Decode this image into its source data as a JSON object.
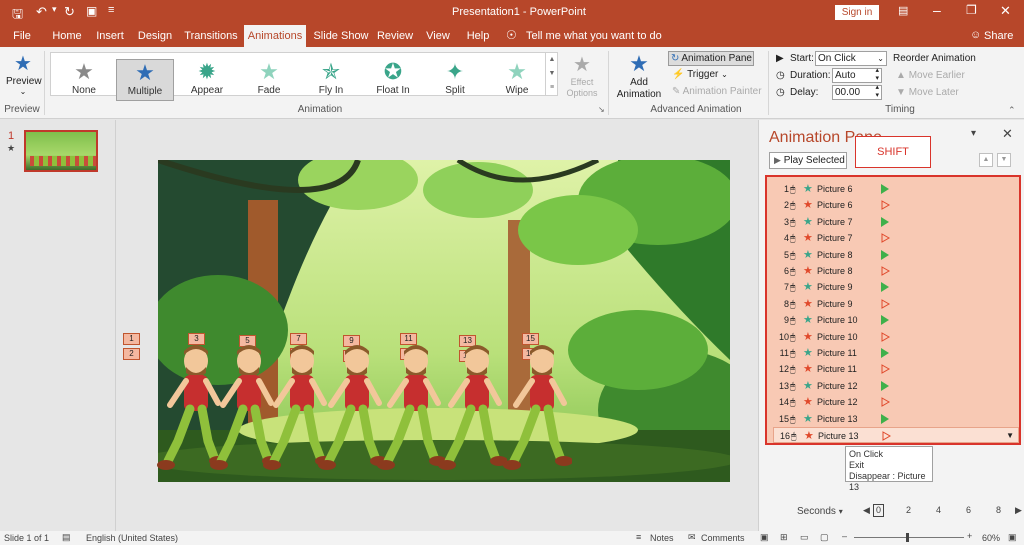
{
  "titlebar": {
    "title": "Presentation1  -  PowerPoint",
    "signin": "Sign in"
  },
  "tabs": [
    "File",
    "Home",
    "Insert",
    "Design",
    "Transitions",
    "Animations",
    "Slide Show",
    "Review",
    "View",
    "Help"
  ],
  "tell_me": "Tell me what you want to do",
  "share": "Share",
  "ribbon": {
    "preview_btn": "Preview",
    "preview_group": "Preview",
    "animations": [
      {
        "label": "None",
        "color": "#8a8a8a"
      },
      {
        "label": "Multiple",
        "color": "#2f6db5"
      },
      {
        "label": "Appear",
        "color": "#3aa58a"
      },
      {
        "label": "Fade",
        "color": "#3aa58a"
      },
      {
        "label": "Fly In",
        "color": "#3aa58a"
      },
      {
        "label": "Float In",
        "color": "#3aa58a"
      },
      {
        "label": "Split",
        "color": "#3aa58a"
      },
      {
        "label": "Wipe",
        "color": "#3aa58a"
      }
    ],
    "effect_options": "Effect Options",
    "animation_group": "Animation",
    "add_animation": "Add Animation",
    "animation_pane_btn": "Animation Pane",
    "trigger": "Trigger",
    "animation_painter": "Animation Painter",
    "advanced_group": "Advanced Animation",
    "start_label": "Start:",
    "start_value": "On Click",
    "duration_label": "Duration:",
    "duration_value": "Auto",
    "delay_label": "Delay:",
    "delay_value": "00.00",
    "timing_group": "Timing",
    "reorder_title": "Reorder Animation",
    "move_earlier": "Move Earlier",
    "move_later": "Move Later"
  },
  "slide_thumb_number": "1",
  "slide_tags": {
    "left": [
      "1",
      "2"
    ],
    "characters": [
      {
        "top": "3",
        "bottom": "4"
      },
      {
        "top": "5",
        "bottom": "6"
      },
      {
        "top": "7",
        "bottom": "8"
      },
      {
        "top": "9",
        "bottom": "10"
      },
      {
        "top": "11",
        "bottom": "12"
      },
      {
        "top": "13",
        "bottom": "14"
      },
      {
        "top": "15",
        "bottom": "16"
      }
    ]
  },
  "pane": {
    "title": "Animation Pane",
    "play_selected": "Play Selected",
    "shift_callout": "SHIFT",
    "items": [
      {
        "num": "1",
        "type": "entrance",
        "name": "Picture 6"
      },
      {
        "num": "2",
        "type": "exit",
        "name": "Picture 6"
      },
      {
        "num": "3",
        "type": "entrance",
        "name": "Picture 7"
      },
      {
        "num": "4",
        "type": "exit",
        "name": "Picture 7"
      },
      {
        "num": "5",
        "type": "entrance",
        "name": "Picture 8"
      },
      {
        "num": "6",
        "type": "exit",
        "name": "Picture 8"
      },
      {
        "num": "7",
        "type": "entrance",
        "name": "Picture 9"
      },
      {
        "num": "8",
        "type": "exit",
        "name": "Picture 9"
      },
      {
        "num": "9",
        "type": "entrance",
        "name": "Picture 10"
      },
      {
        "num": "10",
        "type": "exit",
        "name": "Picture 10"
      },
      {
        "num": "11",
        "type": "entrance",
        "name": "Picture 11"
      },
      {
        "num": "12",
        "type": "exit",
        "name": "Picture 11"
      },
      {
        "num": "13",
        "type": "entrance",
        "name": "Picture 12"
      },
      {
        "num": "14",
        "type": "exit",
        "name": "Picture 12"
      },
      {
        "num": "15",
        "type": "entrance",
        "name": "Picture 13"
      },
      {
        "num": "16",
        "type": "exit",
        "name": "Picture 13"
      }
    ],
    "tooltip": {
      "line1": "On Click",
      "line2": "Exit",
      "line3": "Disappear : Picture 13"
    },
    "seconds_label": "Seconds",
    "timeline_ticks": [
      "0",
      "2",
      "4",
      "6",
      "8"
    ]
  },
  "status": {
    "slide_info": "Slide 1 of 1",
    "language": "English (United States)",
    "notes": "Notes",
    "comments": "Comments",
    "zoom": "60%"
  },
  "colors": {
    "accent": "#b7472a",
    "entrance": "#3aa58a",
    "exit": "#e0492b",
    "selection_fill": "#f8c9b4",
    "selection_border": "#d9342b"
  }
}
